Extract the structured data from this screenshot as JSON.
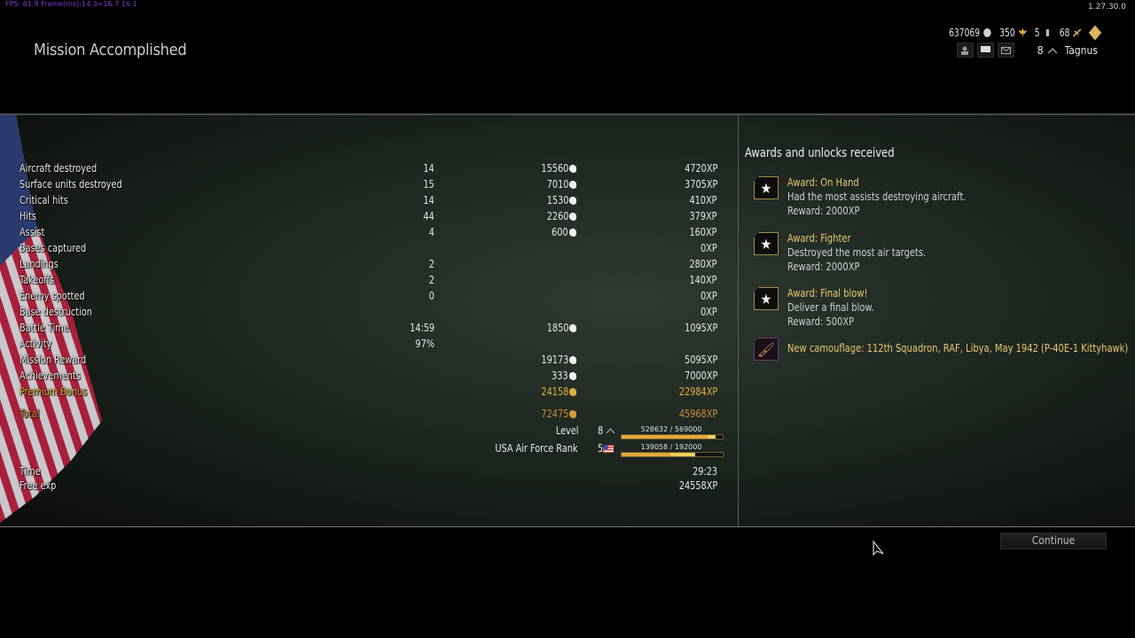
{
  "overlay": {
    "fps": "FPS: 61.9 Frame(ms):14.3<16.7 16.1",
    "version": "1.27.30.0"
  },
  "header": {
    "title": "Mission Accomplished",
    "currencies": {
      "silver_lions": "637069",
      "eagles": "350",
      "item3": "5",
      "item4": "68"
    },
    "player": {
      "level": "8",
      "name": "Tagnus"
    },
    "icons": [
      "lion-icon",
      "eagle-icon",
      "ammo-icon",
      "plane-icon",
      "premium-diamond-icon",
      "friends-icon",
      "chat-icon",
      "mail-icon",
      "level-chevron-icon"
    ]
  },
  "stats": {
    "rows": [
      {
        "label": "Aircraft destroyed",
        "count": "14",
        "lions": "15560",
        "xp": "4720XP"
      },
      {
        "label": "Surface units destroyed",
        "count": "15",
        "lions": "7010",
        "xp": "3705XP"
      },
      {
        "label": "Critical hits",
        "count": "14",
        "lions": "1530",
        "xp": "410XP"
      },
      {
        "label": "Hits",
        "count": "44",
        "lions": "2260",
        "xp": "379XP"
      },
      {
        "label": "Assist",
        "count": "4",
        "lions": "600",
        "xp": "160XP"
      },
      {
        "label": "Bases captured",
        "count": "",
        "lions": "",
        "xp": "0XP"
      },
      {
        "label": "Landings",
        "count": "2",
        "lions": "",
        "xp": "280XP"
      },
      {
        "label": "Takeoffs",
        "count": "2",
        "lions": "",
        "xp": "140XP"
      },
      {
        "label": "Enemy spotted",
        "count": "0",
        "lions": "",
        "xp": "0XP"
      },
      {
        "label": "Base destruction",
        "count": "",
        "lions": "",
        "xp": "0XP"
      },
      {
        "label": "Battle Time",
        "count": "14:59",
        "lions": "1850",
        "xp": "1095XP"
      },
      {
        "label": "Activity",
        "count": "97%",
        "lions": "",
        "xp": ""
      },
      {
        "label": "Mission Reward",
        "count": "",
        "lions": "19173",
        "xp": "5095XP"
      },
      {
        "label": "Achievements",
        "count": "",
        "lions": "333",
        "xp": "7000XP"
      },
      {
        "label": "Premium Bonus",
        "count": "",
        "lions": "24158",
        "xp": "22984XP"
      }
    ],
    "total": {
      "label": "Total",
      "lions": "72475",
      "xp": "45968XP"
    },
    "level": {
      "label": "Level",
      "value": "8",
      "progress_text": "528632 / 569000",
      "progress": 0.929,
      "gain_start": 0.85
    },
    "rank": {
      "label": "USA Air Force Rank",
      "value": "5",
      "progress_text": "139058 / 192000",
      "progress": 0.724,
      "gain_start": 0.48
    },
    "time": {
      "label": "Time",
      "value": "29:23"
    },
    "free_exp": {
      "label": "Free exp",
      "value": "24558XP"
    }
  },
  "awards": {
    "title": "Awards and unlocks received",
    "items": [
      {
        "name": "Award: On Hand",
        "desc": "Had the most assists destroying aircraft.",
        "reward": "Reward: 2000XP"
      },
      {
        "name": "Award: Fighter",
        "desc": "Destroyed the most air targets.",
        "reward": "Reward: 2000XP"
      },
      {
        "name": "Award: Final blow!",
        "desc": "Deliver a final blow.",
        "reward": "Reward: 500XP"
      }
    ],
    "unlock": {
      "text": "New camouflage: 112th Squadron, RAF, Libya, May 1942 (P-40E-1 Kittyhawk)"
    }
  },
  "buttons": {
    "continue": "Continue"
  }
}
